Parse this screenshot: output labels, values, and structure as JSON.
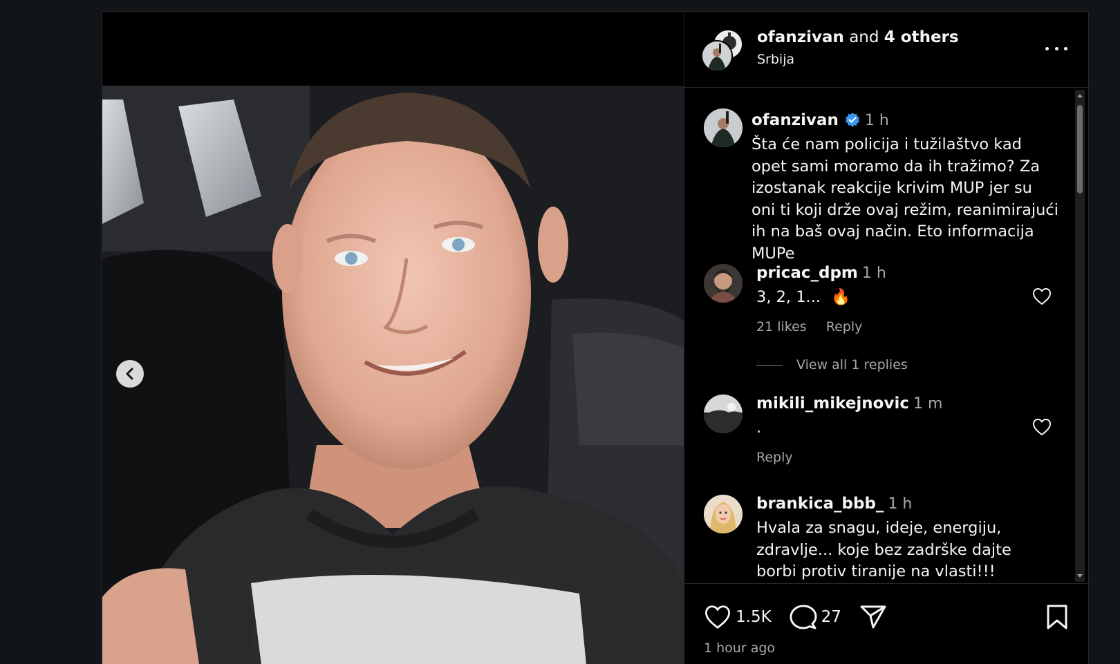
{
  "header": {
    "author": "ofanzivan",
    "joiner": "and",
    "others": "4 others",
    "location": "Srbija"
  },
  "caption": {
    "username": "ofanzivan",
    "time": "1 h",
    "text": "Šta će nam policija i tužilaštvo kad opet sami moramo da ih tražimo? Za izostanak reakcije krivim MUP jer su oni ti koji drže ovaj režim, reanimirajući ih na baš ovaj način. Eto informacija MUPe"
  },
  "comments": [
    {
      "username": "pricac_dpm",
      "time": "1 h",
      "text": "3, 2, 1...",
      "emoji": "🔥",
      "likes": "21 likes",
      "reply": "Reply"
    },
    {
      "username": "mikili_mikejnovic",
      "time": "1 m",
      "text": ".",
      "reply": "Reply"
    },
    {
      "username": "brankica_bbb_",
      "time": "1 h",
      "text": "Hvala za snagu, ideje, energiju, zdravlje... koje bez zadrške dajte borbi protiv tiranije na vlasti!!!"
    }
  ],
  "view_replies": "View all 1 replies",
  "footer": {
    "likes": "1.5K",
    "comments": "27",
    "posted": "1 hour ago"
  },
  "icons": [
    "chevron-left-icon",
    "more-icon",
    "verified-icon",
    "heart-icon",
    "comment-icon",
    "share-icon",
    "bookmark-icon"
  ],
  "colors": {
    "background": "#111419",
    "panel": "#000000",
    "muted": "#a8a8a8",
    "verified": "#3897f0"
  }
}
